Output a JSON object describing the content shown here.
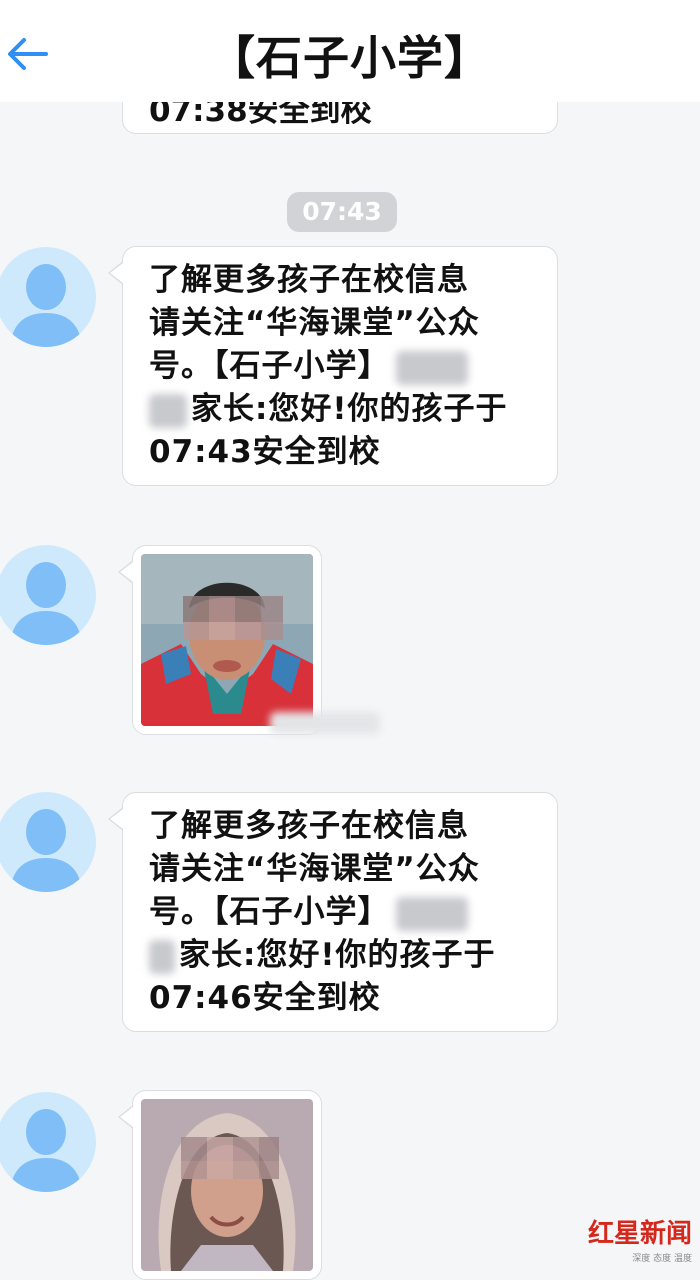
{
  "header": {
    "title": "【石子小学】",
    "back_icon": "back-arrow-icon"
  },
  "top_message": {
    "partial_text": "07:38安全到校"
  },
  "time_divider": "07:43",
  "messages": [
    {
      "line1": "了解更多孩子在校信息",
      "line2": "请关注“华海课堂”公众",
      "line3": "号。【石子小学】",
      "line4": "家长:您好!你的孩子于",
      "line5": "07:43安全到校"
    },
    {
      "line1": "了解更多孩子在校信息",
      "line2": "请关注“华海课堂”公众",
      "line3": "号。【石子小学】",
      "line4": "家长:您好!你的孩子于",
      "line5": "07:46安全到校"
    }
  ],
  "watermark": {
    "main": "红星新闻",
    "sub": "深度 态度 温度"
  },
  "colors": {
    "accent": "#2f8ff5",
    "avatar_bg": "#cfe9fc",
    "avatar_fg": "#7fbef7",
    "watermark_red": "#d4281c"
  }
}
